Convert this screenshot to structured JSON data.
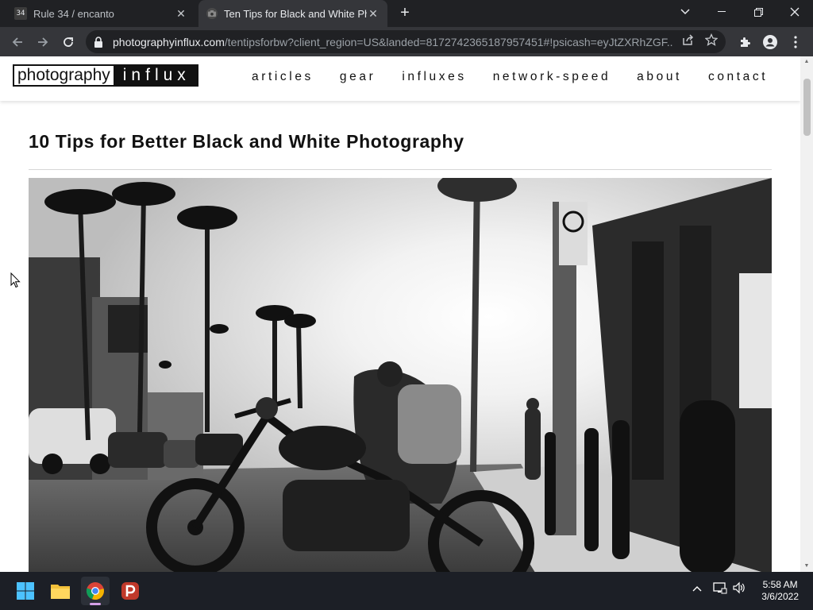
{
  "browser": {
    "tabs": [
      {
        "favicon_text": "34",
        "title": "Rule 34 / encanto",
        "active": false
      },
      {
        "favicon_text": "",
        "title": "Ten Tips for Black and White Pho",
        "active": true
      }
    ],
    "url_host": "photographyinflux.com",
    "url_path": "/tentipsforbw?client_region=US&landed=8172742365187957451#!psicash=eyJtZXRhZGF..."
  },
  "site": {
    "logo_part1": "photography",
    "logo_part2": "influx",
    "nav": [
      "articles",
      "gear",
      "influxes",
      "network-speed",
      "about",
      "contact"
    ]
  },
  "article": {
    "title": "10 Tips for Better Black and White Photography"
  },
  "taskbar": {
    "time": "5:58 AM",
    "date": "3/6/2022"
  },
  "colors": {
    "chrome_dark": "#202124",
    "chrome_toolbar": "#35363a",
    "page_bg": "#ffffff",
    "text": "#111111"
  }
}
